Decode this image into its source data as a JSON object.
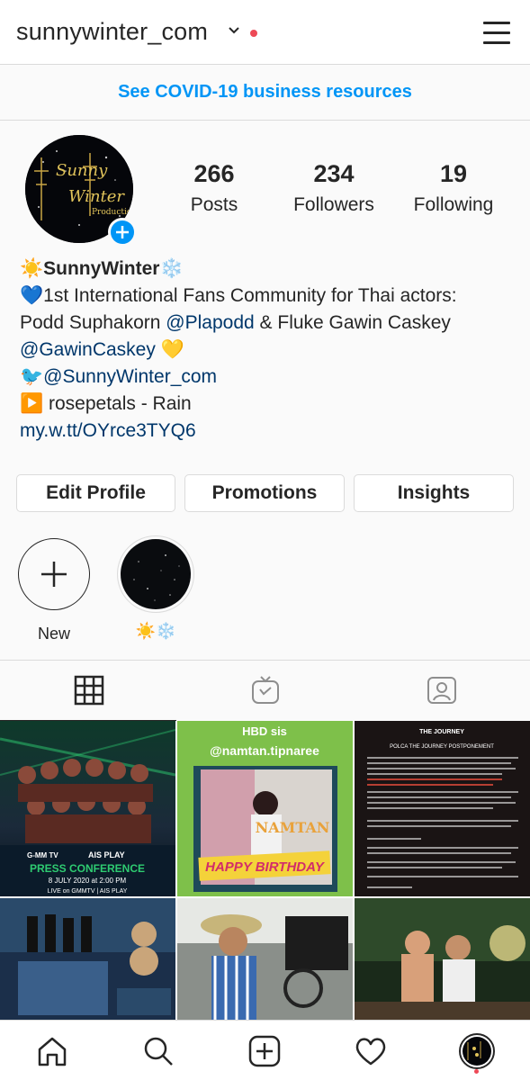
{
  "header": {
    "username": "sunnywinter_com",
    "chevron_icon": "chevron-down-icon",
    "menu_icon": "hamburger-menu-icon"
  },
  "banner": {
    "text": "See COVID-19 business resources"
  },
  "profile": {
    "avatar_text_1": "Sunny",
    "avatar_text_2": "Winter",
    "avatar_text_3": "Production",
    "stats": [
      {
        "num": "266",
        "label": "Posts"
      },
      {
        "num": "234",
        "label": "Followers"
      },
      {
        "num": "19",
        "label": "Following"
      }
    ],
    "bio": {
      "name": "☀️SunnyWinter❄️",
      "line1": "💙1st International Fans Community for Thai actors:",
      "line2_prefix": "Podd Suphakorn ",
      "line2_mention": "@Plapodd",
      "line2_suffix": " & Fluke Gawin Caskey",
      "line3_mention": "@GawinCaskey",
      "line3_suffix": " 💛",
      "line4_prefix": "🐦",
      "line4_mention": "@SunnyWinter_com",
      "line5": "▶️ rosepetals - Rain",
      "link": "my.w.tt/OYrce3TYQ6"
    }
  },
  "buttons": {
    "edit_profile": "Edit Profile",
    "promotions": "Promotions",
    "insights": "Insights"
  },
  "highlights": [
    {
      "label": "New",
      "icon": "plus-icon"
    },
    {
      "label": "☀️❄️",
      "icon": "starry-sky"
    }
  ],
  "tabs": [
    {
      "icon": "grid-icon",
      "active": true
    },
    {
      "icon": "igtv-icon",
      "active": false
    },
    {
      "icon": "tagged-icon",
      "active": false
    }
  ],
  "grid": {
    "post1": {
      "line1": "PRESS CONFERENCE",
      "line2": "8 JULY 2020 at 2:00 PM",
      "line3": "LIVE on GMMTV | AIS PLAY",
      "brand1": "G-MM TV",
      "brand2": "AIS PLAY"
    },
    "post2": {
      "title": "HBD sis",
      "mention": "@namtan.tipnaree",
      "name": "NAMTAN",
      "banner": "HAPPY BIRTHDAY"
    },
    "post3": {
      "title": "THE JOURNEY",
      "subtitle": "POLCA THE JOURNEY POSTPONEMENT"
    }
  },
  "bottom_nav": [
    {
      "icon": "home-icon"
    },
    {
      "icon": "search-icon"
    },
    {
      "icon": "new-post-icon"
    },
    {
      "icon": "heart-icon"
    },
    {
      "icon": "profile-avatar-icon"
    }
  ]
}
